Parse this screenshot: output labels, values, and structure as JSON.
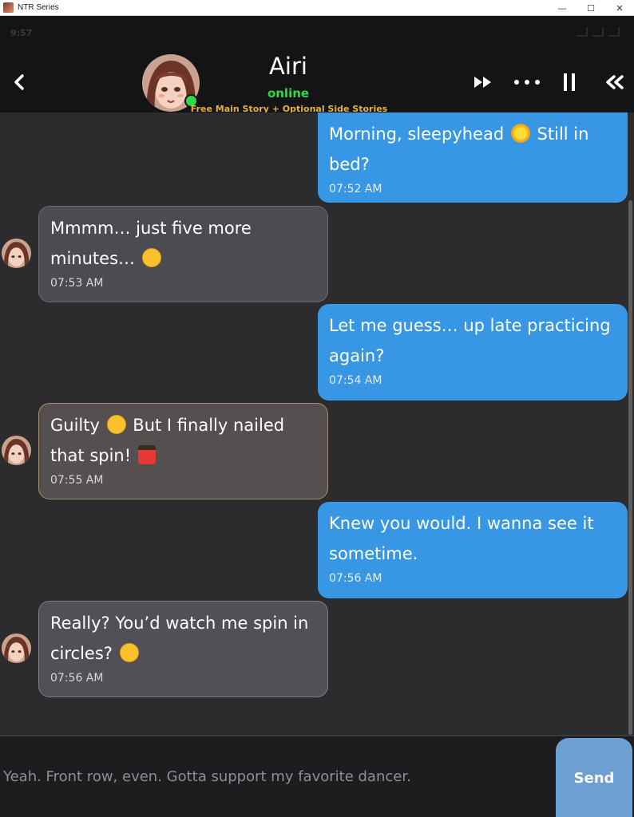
{
  "window": {
    "title": "NTR Series",
    "controls": [
      "—",
      "☐",
      "✕"
    ]
  },
  "statusbar": {
    "time": "9:57"
  },
  "header": {
    "back_icon": "chevron-left-icon",
    "name": "Airi",
    "status": "online",
    "subtitle": "Free Main Story + Optional Side Stories",
    "controls": [
      "fast-forward-icon",
      "more-icon",
      "pause-icon",
      "rewind-icon"
    ]
  },
  "messages": [
    {
      "side": "out",
      "text": "Morning, sleepyhead",
      "emoji": "sun-emoji",
      "text_after": "Still in bed?",
      "time": "07:52 AM"
    },
    {
      "side": "in",
      "text": "Mmmm… just five more minutes…",
      "emoji": "sleepy-face-emoji",
      "time": "07:53 AM"
    },
    {
      "side": "out",
      "text": "Let me guess… up late practicing again?",
      "time": "07:54 AM"
    },
    {
      "side": "in",
      "text": "Guilty",
      "emoji": "persevering-face-emoji",
      "text_after": "But I finally nailed that spin!",
      "emoji_after": "dancer-emoji",
      "time": "07:55 AM"
    },
    {
      "side": "out",
      "text": "Knew you would. I wanna see it sometime.",
      "time": "07:56 AM"
    },
    {
      "side": "in",
      "text": "Really? You’d watch me spin in circles?",
      "emoji": "flushed-face-emoji",
      "time": "07:56 AM"
    }
  ],
  "composer": {
    "text": "Yeah. Front row, even. Gotta support my favorite dancer.",
    "send_label": "Send"
  },
  "colors": {
    "outgoing_bubble": "#3897e5",
    "incoming_bubble": "#4b4b52",
    "online": "#2bd94b",
    "subtitle": "#e3b23c",
    "send_button": "#6e9fd3"
  }
}
